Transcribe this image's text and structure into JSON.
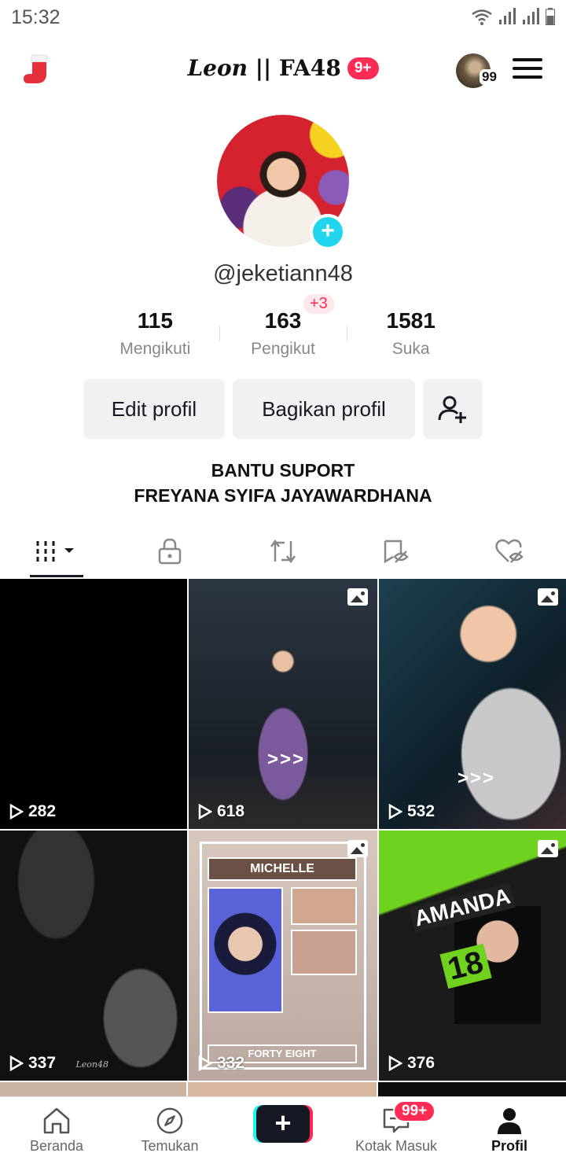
{
  "status_bar": {
    "time": "15:32"
  },
  "header": {
    "title_italic": "Leon",
    "title_rest": " || FA48",
    "notification_badge": "9+",
    "mini_avatar_count": "99"
  },
  "profile": {
    "username": "@jeketiann48",
    "followers_delta": "+3",
    "stats": [
      {
        "value": "115",
        "label": "Mengikuti"
      },
      {
        "value": "163",
        "label": "Pengikut"
      },
      {
        "value": "1581",
        "label": "Suka"
      }
    ],
    "edit_button": "Edit profil",
    "share_button": "Bagikan profil",
    "bio_line1": "BANTU SUPORT",
    "bio_line2": "FREYANA SYIFA JAYAWARDHANA"
  },
  "tabs": [
    "videos-tab",
    "private-tab",
    "reposts-tab",
    "favorites-tab",
    "liked-tab"
  ],
  "videos": [
    {
      "views": "282",
      "photo": false,
      "arrows": ""
    },
    {
      "views": "618",
      "photo": true,
      "arrows": ">>>"
    },
    {
      "views": "532",
      "photo": true,
      "arrows": ">>>"
    },
    {
      "views": "337",
      "photo": false,
      "arrows": "",
      "watermark": "Leon48"
    },
    {
      "views": "332",
      "photo": true,
      "name_text": "MICHELLE",
      "footer_text": "FORTY EIGHT"
    },
    {
      "views": "376",
      "photo": true,
      "name_text": "AMANDA",
      "number_text": "18"
    }
  ],
  "bottom_nav": {
    "home": "Beranda",
    "discover": "Temukan",
    "inbox": "Kotak Masuk",
    "inbox_badge": "99+",
    "profile": "Profil"
  },
  "colors": {
    "accent": "#fe2c55",
    "cyan": "#20d5ec",
    "text": "#161823"
  }
}
